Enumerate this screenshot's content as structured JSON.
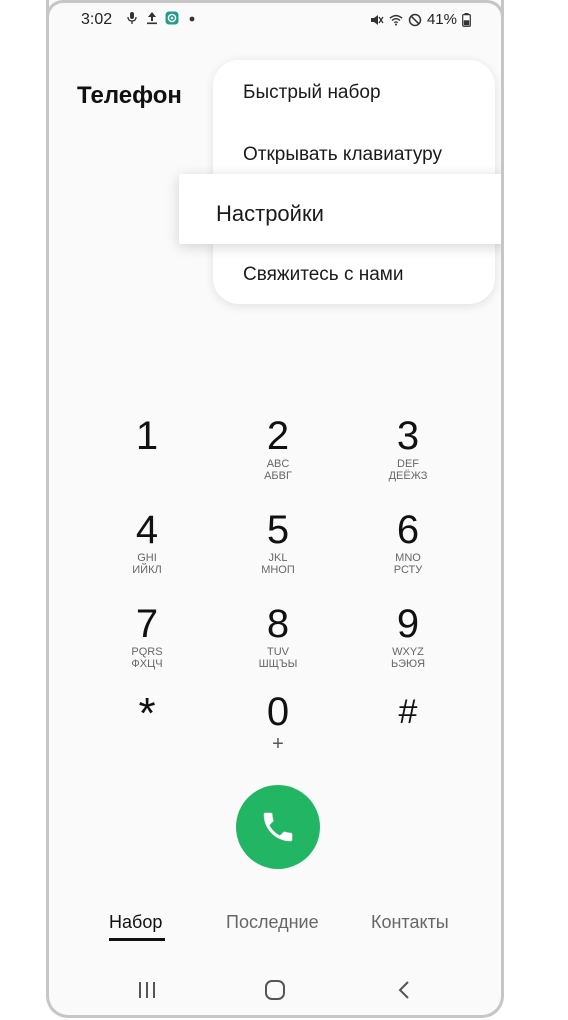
{
  "status_bar": {
    "time": "3:02",
    "battery": "41%",
    "left_icons": [
      "mic-icon",
      "upload-icon",
      "app-notification-icon",
      "dot-icon"
    ],
    "right_icons": [
      "mute-icon",
      "wifi-icon",
      "no-disturb-icon",
      "battery-icon"
    ]
  },
  "app": {
    "title": "Телефон"
  },
  "menu": {
    "items": [
      {
        "label": "Быстрый набор"
      },
      {
        "label": "Открывать клавиатуру"
      },
      {
        "label": "Настройки"
      },
      {
        "label": "Свяжитесь с нами"
      }
    ]
  },
  "keypad": {
    "keys": [
      {
        "digit": "1",
        "latin": "",
        "cyrillic": ""
      },
      {
        "digit": "2",
        "latin": "ABC",
        "cyrillic": "АБВГ"
      },
      {
        "digit": "3",
        "latin": "DEF",
        "cyrillic": "ДЕЁЖЗ"
      },
      {
        "digit": "4",
        "latin": "GHI",
        "cyrillic": "ИЙКЛ"
      },
      {
        "digit": "5",
        "latin": "JKL",
        "cyrillic": "МНОП"
      },
      {
        "digit": "6",
        "latin": "MNO",
        "cyrillic": "РСТУ"
      },
      {
        "digit": "7",
        "latin": "PQRS",
        "cyrillic": "ФХЦЧ"
      },
      {
        "digit": "8",
        "latin": "TUV",
        "cyrillic": "ШЩЪЫ"
      },
      {
        "digit": "9",
        "latin": "WXYZ",
        "cyrillic": "ЬЭЮЯ"
      },
      {
        "digit": "*",
        "latin": "",
        "cyrillic": ""
      },
      {
        "digit": "0",
        "latin": "+",
        "cyrillic": ""
      },
      {
        "digit": "#",
        "latin": "",
        "cyrillic": ""
      }
    ]
  },
  "call_button": {
    "icon": "phone-icon",
    "color": "#22b664"
  },
  "tabs": [
    {
      "label": "Набор",
      "active": true
    },
    {
      "label": "Последние",
      "active": false
    },
    {
      "label": "Контакты",
      "active": false
    }
  ],
  "nav_bar": {
    "icons": [
      "recent-apps-icon",
      "home-icon",
      "back-icon"
    ]
  }
}
